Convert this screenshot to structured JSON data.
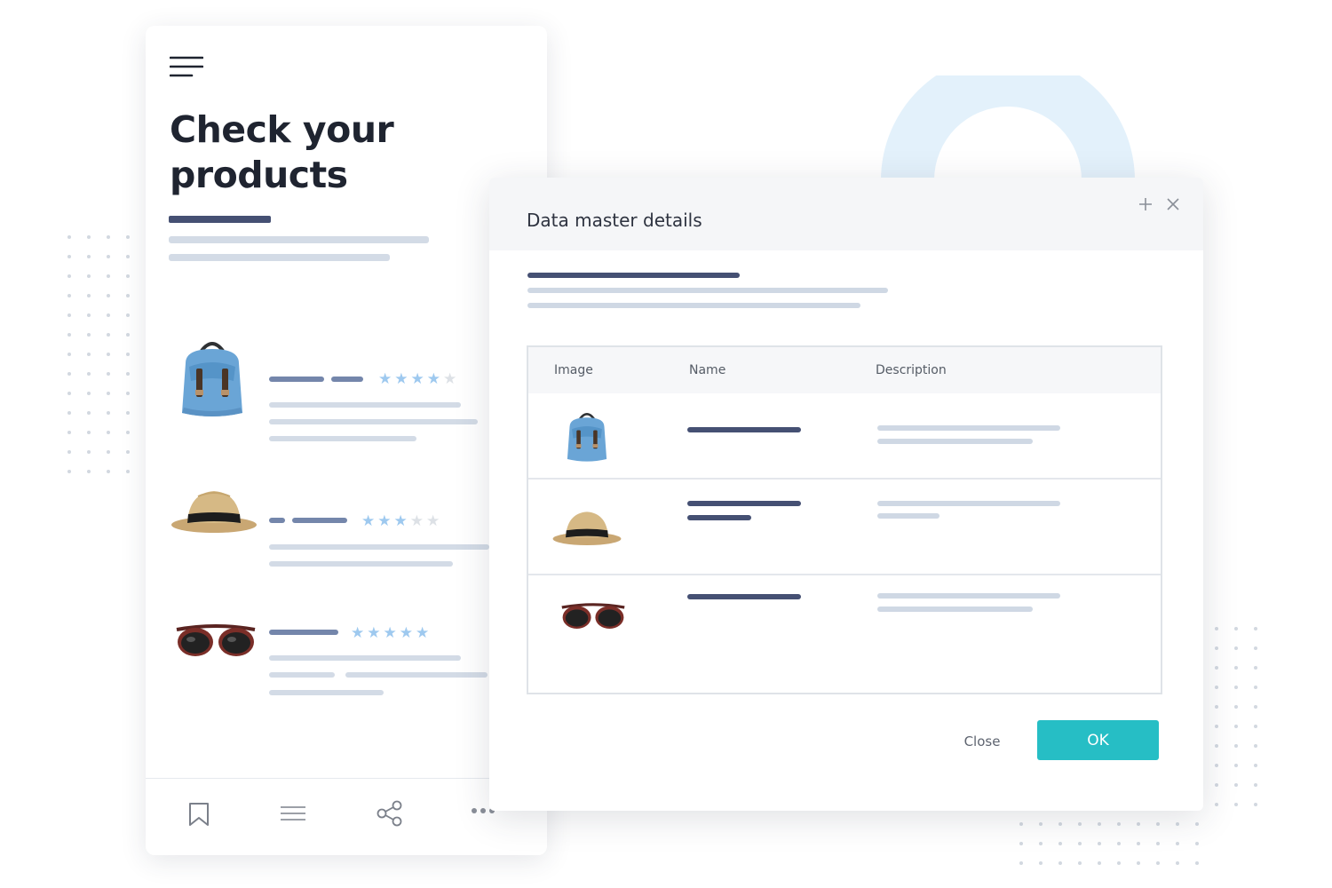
{
  "hero": {
    "title": "Check your\nproducts"
  },
  "products": [
    {
      "name": "Backpack",
      "rating": 4,
      "max_rating": 5
    },
    {
      "name": "Straw hat",
      "rating": 3,
      "max_rating": 5
    },
    {
      "name": "Sunglasses",
      "rating": 5,
      "max_rating": 5
    }
  ],
  "dialog": {
    "title": "Data master details",
    "columns": [
      "Image",
      "Name",
      "Description"
    ],
    "close_label": "Close",
    "ok_label": "OK"
  },
  "colors": {
    "accent": "#26bec5",
    "heading_bar": "#455073",
    "text_placeholder": "#d3dbe6",
    "star_on": "#9ec9ef",
    "star_off": "#dde1e6",
    "ring": "#e3f1fb"
  },
  "icons": [
    "hamburger-menu-icon",
    "bookmark-icon",
    "list-icon",
    "share-icon",
    "more-icon",
    "plus-icon",
    "close-icon"
  ]
}
